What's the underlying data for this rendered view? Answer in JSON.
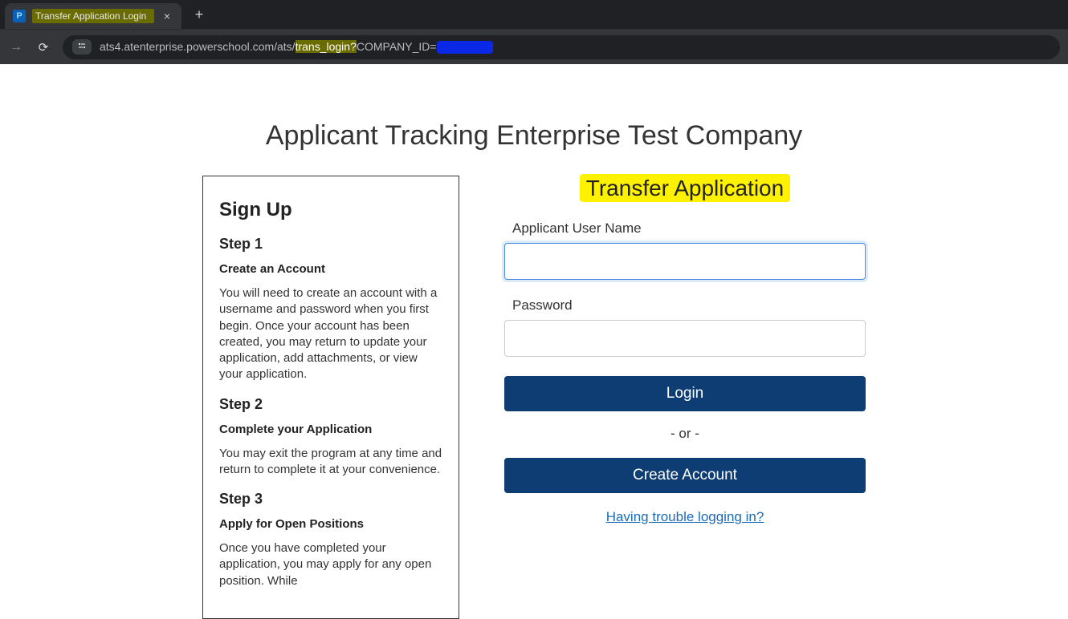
{
  "browser": {
    "tab_title": "Transfer Application Login",
    "favicon_letter": "P",
    "url_prefix": "ats4.atenterprise.powerschool.com/ats/",
    "url_highlight": "trans_login?",
    "url_suffix": "COMPANY_ID="
  },
  "page": {
    "company_title": "Applicant Tracking Enterprise Test Company"
  },
  "signup": {
    "heading": "Sign Up",
    "steps": [
      {
        "title": "Step 1",
        "subtitle": "Create an Account",
        "body": "You will need to create an account with a username and password when you first begin. Once your account has been created, you may return to update your application, add attachments, or view your application."
      },
      {
        "title": "Step 2",
        "subtitle": "Complete your Application",
        "body": "You may exit the program at any time and return to complete it at your convenience."
      },
      {
        "title": "Step 3",
        "subtitle": "Apply for Open Positions",
        "body": "Once you have completed your application, you may apply for any open position. While"
      }
    ]
  },
  "login": {
    "heading": "Transfer Application",
    "username_label": "Applicant User Name",
    "password_label": "Password",
    "login_button": "Login",
    "or_text": "- or -",
    "create_button": "Create Account",
    "help_link": "Having trouble logging in?"
  }
}
